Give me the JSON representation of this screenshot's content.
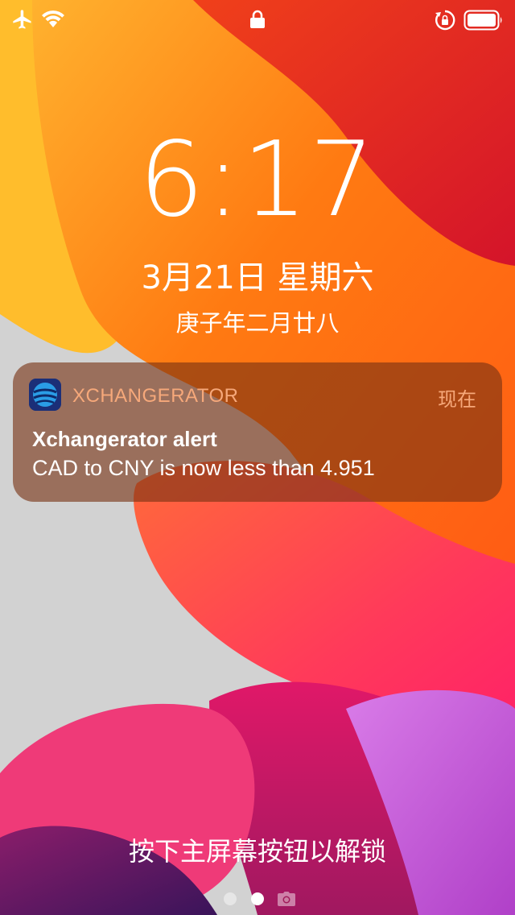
{
  "status_bar": {
    "icons": [
      "airplane-icon",
      "wifi-icon",
      "lock-icon",
      "rotation-lock-icon",
      "battery-icon"
    ]
  },
  "lock_screen": {
    "time": "6:17",
    "date": "3月21日 星期六",
    "lunar_date": "庚子年二月廿八"
  },
  "notification": {
    "app_name": "XCHANGERATOR",
    "time_label": "现在",
    "title": "Xchangerator alert",
    "body": "CAD to CNY is now less than 4.951",
    "app_icon": "globe-icon"
  },
  "unlock_hint": "按下主屏幕按钮以解锁",
  "page_indicator": {
    "pages": [
      "page-1",
      "page-2",
      "camera"
    ],
    "current": 2
  },
  "colors": {
    "notification_bg": "#782e14",
    "app_name_color": "#f6a87a",
    "wallpaper_orange": "#ff7a10",
    "wallpaper_red": "#e8203a",
    "wallpaper_pink": "#ff2d6e",
    "wallpaper_purple": "#c24fd0"
  }
}
